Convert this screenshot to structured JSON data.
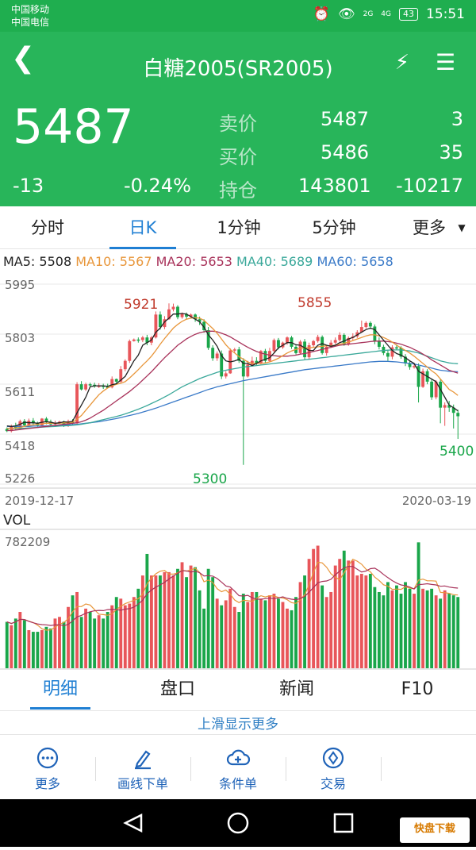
{
  "status": {
    "carrier1": "中国移动",
    "carrier2": "中国电信",
    "net1": "2G",
    "net2": "4G",
    "battery": "43",
    "time": "15:51"
  },
  "header": {
    "title": "白糖2005(SR2005)",
    "price": "5487",
    "change": "-13",
    "change_pct": "-0.24%",
    "sell_label": "卖价",
    "sell_price": "5487",
    "sell_vol": "3",
    "buy_label": "买价",
    "buy_price": "5486",
    "buy_vol": "35",
    "oi_label": "持仓",
    "oi": "143801",
    "oi_change": "-10217"
  },
  "tabs": {
    "t0": "分时",
    "t1": "日K",
    "t2": "1分钟",
    "t3": "5分钟",
    "t4": "更多"
  },
  "ma": {
    "ma5": "MA5: 5508",
    "ma10": "MA10: 5567",
    "ma20": "MA20: 5653",
    "ma40": "MA40: 5689",
    "ma60": "MA60: 5658"
  },
  "colors": {
    "up": "#e8565a",
    "down": "#1aa64a",
    "ma5": "#222222",
    "ma10": "#e8963a",
    "ma20": "#a8325a",
    "ma40": "#3aa89a",
    "ma60": "#3a7ac8",
    "header": "#28b55a",
    "accent": "#1f7fd3"
  },
  "chart_data": {
    "type": "candlestick",
    "y_ticks": [
      "5995",
      "5803",
      "5611",
      "5418",
      "5226"
    ],
    "ylim": [
      5226,
      5995
    ],
    "x_start": "2019-12-17",
    "x_end": "2020-03-19",
    "high_label": "5921",
    "low_label": "5300",
    "mid_label": "5855",
    "last_label": "5400",
    "vol_title": "VOL",
    "vol_max": "782209",
    "candles": [
      [
        5438,
        5430,
        5444,
        5426,
        280
      ],
      [
        5430,
        5450,
        5455,
        5425,
        260
      ],
      [
        5450,
        5440,
        5462,
        5432,
        300
      ],
      [
        5440,
        5468,
        5474,
        5438,
        340
      ],
      [
        5468,
        5452,
        5476,
        5446,
        290
      ],
      [
        5452,
        5470,
        5478,
        5448,
        230
      ],
      [
        5470,
        5460,
        5480,
        5452,
        220
      ],
      [
        5460,
        5452,
        5466,
        5446,
        220
      ],
      [
        5452,
        5478,
        5480,
        5448,
        230
      ],
      [
        5478,
        5466,
        5484,
        5456,
        250
      ],
      [
        5466,
        5456,
        5474,
        5448,
        240
      ],
      [
        5456,
        5462,
        5470,
        5452,
        300
      ],
      [
        5462,
        5466,
        5470,
        5458,
        310
      ],
      [
        5466,
        5452,
        5470,
        5446,
        280
      ],
      [
        5452,
        5468,
        5474,
        5446,
        370
      ],
      [
        5468,
        5460,
        5476,
        5454,
        440
      ],
      [
        5460,
        5610,
        5618,
        5456,
        460
      ],
      [
        5610,
        5590,
        5622,
        5586,
        310
      ],
      [
        5590,
        5610,
        5616,
        5584,
        360
      ],
      [
        5610,
        5608,
        5616,
        5598,
        340
      ],
      [
        5608,
        5602,
        5616,
        5596,
        300
      ],
      [
        5602,
        5604,
        5614,
        5596,
        320
      ],
      [
        5604,
        5600,
        5612,
        5592,
        300
      ],
      [
        5600,
        5598,
        5612,
        5594,
        340
      ],
      [
        5598,
        5630,
        5640,
        5594,
        380
      ],
      [
        5630,
        5620,
        5632,
        5614,
        430
      ],
      [
        5620,
        5668,
        5680,
        5616,
        420
      ],
      [
        5668,
        5700,
        5706,
        5660,
        380
      ],
      [
        5700,
        5776,
        5782,
        5692,
        390
      ],
      [
        5776,
        5782,
        5786,
        5774,
        430
      ],
      [
        5782,
        5780,
        5790,
        5770,
        480
      ],
      [
        5780,
        5790,
        5796,
        5772,
        560
      ],
      [
        5790,
        5770,
        5800,
        5760,
        690
      ],
      [
        5770,
        5790,
        5796,
        5760,
        560
      ],
      [
        5790,
        5878,
        5890,
        5786,
        560
      ],
      [
        5878,
        5830,
        5890,
        5820,
        560
      ],
      [
        5830,
        5860,
        5872,
        5822,
        580
      ],
      [
        5860,
        5898,
        5921,
        5858,
        580
      ],
      [
        5898,
        5908,
        5920,
        5890,
        560
      ],
      [
        5908,
        5868,
        5914,
        5860,
        600
      ],
      [
        5868,
        5880,
        5886,
        5862,
        640
      ],
      [
        5880,
        5870,
        5886,
        5860,
        550
      ],
      [
        5870,
        5878,
        5882,
        5864,
        620
      ],
      [
        5878,
        5860,
        5882,
        5850,
        610
      ],
      [
        5860,
        5850,
        5870,
        5838,
        470
      ],
      [
        5850,
        5818,
        5860,
        5808,
        360
      ],
      [
        5818,
        5750,
        5830,
        5742,
        600
      ],
      [
        5750,
        5710,
        5760,
        5700,
        550
      ],
      [
        5710,
        5728,
        5736,
        5700,
        420
      ],
      [
        5728,
        5640,
        5740,
        5630,
        380
      ],
      [
        5640,
        5652,
        5660,
        5632,
        410
      ],
      [
        5652,
        5740,
        5748,
        5650,
        480
      ],
      [
        5740,
        5744,
        5750,
        5732,
        370
      ],
      [
        5744,
        5700,
        5754,
        5692,
        340
      ],
      [
        5700,
        5640,
        5710,
        5300,
        450
      ],
      [
        5640,
        5686,
        5700,
        5636,
        400
      ],
      [
        5686,
        5700,
        5716,
        5682,
        460
      ],
      [
        5700,
        5690,
        5714,
        5684,
        460
      ],
      [
        5690,
        5738,
        5742,
        5686,
        420
      ],
      [
        5738,
        5700,
        5746,
        5690,
        410
      ],
      [
        5700,
        5738,
        5750,
        5696,
        440
      ],
      [
        5738,
        5780,
        5786,
        5730,
        450
      ],
      [
        5780,
        5752,
        5788,
        5744,
        420
      ],
      [
        5752,
        5770,
        5774,
        5746,
        400
      ],
      [
        5770,
        5790,
        5794,
        5762,
        360
      ],
      [
        5790,
        5754,
        5796,
        5746,
        350
      ],
      [
        5754,
        5730,
        5760,
        5724,
        430
      ],
      [
        5730,
        5774,
        5780,
        5726,
        520
      ],
      [
        5774,
        5714,
        5784,
        5706,
        560
      ],
      [
        5714,
        5760,
        5770,
        5706,
        660
      ],
      [
        5760,
        5776,
        5780,
        5752,
        720
      ],
      [
        5776,
        5792,
        5800,
        5770,
        740
      ],
      [
        5792,
        5730,
        5798,
        5724,
        500
      ],
      [
        5730,
        5754,
        5758,
        5720,
        430
      ],
      [
        5754,
        5770,
        5780,
        5750,
        460
      ],
      [
        5770,
        5780,
        5790,
        5764,
        620
      ],
      [
        5780,
        5800,
        5810,
        5774,
        660
      ],
      [
        5800,
        5764,
        5806,
        5758,
        710
      ],
      [
        5764,
        5788,
        5794,
        5758,
        650
      ],
      [
        5788,
        5794,
        5806,
        5780,
        650
      ],
      [
        5794,
        5810,
        5818,
        5788,
        560
      ],
      [
        5810,
        5830,
        5855,
        5808,
        570
      ],
      [
        5830,
        5846,
        5852,
        5824,
        560
      ],
      [
        5846,
        5832,
        5852,
        5822,
        570
      ],
      [
        5832,
        5776,
        5840,
        5764,
        490
      ],
      [
        5776,
        5754,
        5790,
        5744,
        460
      ],
      [
        5754,
        5730,
        5762,
        5722,
        440
      ],
      [
        5730,
        5716,
        5740,
        5700,
        520
      ],
      [
        5716,
        5752,
        5760,
        5706,
        470
      ],
      [
        5752,
        5750,
        5764,
        5742,
        500
      ],
      [
        5750,
        5716,
        5756,
        5708,
        450
      ],
      [
        5716,
        5690,
        5726,
        5680,
        520
      ],
      [
        5690,
        5676,
        5700,
        5666,
        480
      ],
      [
        5676,
        5680,
        5690,
        5670,
        450
      ],
      [
        5680,
        5600,
        5690,
        5540,
        760
      ],
      [
        5600,
        5660,
        5670,
        5596,
        480
      ],
      [
        5660,
        5620,
        5668,
        5610,
        470
      ],
      [
        5620,
        5560,
        5630,
        5550,
        480
      ],
      [
        5560,
        5620,
        5626,
        5552,
        440
      ],
      [
        5620,
        5520,
        5630,
        5460,
        420
      ],
      [
        5520,
        5530,
        5540,
        5450,
        470
      ],
      [
        5530,
        5520,
        5546,
        5504,
        450
      ],
      [
        5520,
        5500,
        5532,
        5440,
        440
      ],
      [
        5500,
        5487,
        5512,
        5400,
        430
      ]
    ],
    "ma_series": {
      "ma5": [
        5450,
        5448,
        5450,
        5456,
        5464,
        5462,
        5462,
        5460,
        5464,
        5466,
        5464,
        5460,
        5462,
        5466,
        5464,
        5468,
        5500,
        5530,
        5560,
        5600,
        5604,
        5604,
        5604,
        5602,
        5608,
        5612,
        5626,
        5640,
        5670,
        5700,
        5722,
        5760,
        5770,
        5780,
        5810,
        5826,
        5850,
        5864,
        5880,
        5880,
        5882,
        5880,
        5870,
        5860,
        5850,
        5830,
        5800,
        5780,
        5756,
        5720,
        5700,
        5696,
        5700,
        5706,
        5690,
        5690,
        5682,
        5690,
        5700,
        5706,
        5712,
        5730,
        5750,
        5760,
        5770,
        5770,
        5762,
        5760,
        5750,
        5740,
        5740,
        5760,
        5766,
        5760,
        5756,
        5760,
        5770,
        5776,
        5784,
        5790,
        5800,
        5810,
        5820,
        5826,
        5820,
        5800,
        5780,
        5760,
        5740,
        5728,
        5722,
        5712,
        5700,
        5690,
        5660,
        5650,
        5640,
        5630,
        5620,
        5590,
        5560,
        5530,
        5520,
        5508
      ],
      "ma10": [
        5440,
        5440,
        5442,
        5444,
        5448,
        5452,
        5454,
        5456,
        5458,
        5460,
        5460,
        5460,
        5460,
        5462,
        5462,
        5464,
        5476,
        5490,
        5510,
        5530,
        5550,
        5570,
        5584,
        5596,
        5604,
        5610,
        5614,
        5620,
        5634,
        5650,
        5666,
        5684,
        5700,
        5718,
        5740,
        5764,
        5786,
        5806,
        5826,
        5840,
        5852,
        5860,
        5864,
        5866,
        5864,
        5856,
        5840,
        5824,
        5806,
        5784,
        5762,
        5744,
        5730,
        5716,
        5706,
        5696,
        5690,
        5690,
        5690,
        5692,
        5696,
        5702,
        5710,
        5720,
        5730,
        5738,
        5744,
        5748,
        5750,
        5750,
        5752,
        5754,
        5756,
        5758,
        5758,
        5760,
        5764,
        5768,
        5772,
        5778,
        5784,
        5790,
        5796,
        5800,
        5800,
        5796,
        5790,
        5782,
        5772,
        5760,
        5750,
        5740,
        5730,
        5718,
        5704,
        5690,
        5676,
        5662,
        5650,
        5630,
        5610,
        5590,
        5580,
        5567
      ],
      "ma20": [
        5432,
        5432,
        5434,
        5436,
        5438,
        5440,
        5442,
        5444,
        5446,
        5448,
        5450,
        5452,
        5454,
        5456,
        5458,
        5460,
        5462,
        5466,
        5472,
        5480,
        5490,
        5500,
        5510,
        5522,
        5534,
        5546,
        5558,
        5570,
        5582,
        5596,
        5610,
        5626,
        5642,
        5658,
        5676,
        5694,
        5712,
        5728,
        5744,
        5760,
        5772,
        5784,
        5794,
        5802,
        5808,
        5812,
        5814,
        5814,
        5812,
        5806,
        5800,
        5792,
        5782,
        5772,
        5762,
        5752,
        5744,
        5736,
        5730,
        5726,
        5722,
        5720,
        5718,
        5718,
        5718,
        5720,
        5722,
        5726,
        5728,
        5732,
        5736,
        5740,
        5744,
        5748,
        5752,
        5756,
        5760,
        5762,
        5764,
        5766,
        5768,
        5770,
        5772,
        5774,
        5776,
        5776,
        5776,
        5774,
        5772,
        5768,
        5764,
        5758,
        5752,
        5744,
        5736,
        5726,
        5716,
        5704,
        5694,
        5684,
        5674,
        5664,
        5658,
        5653
      ],
      "ma40": [
        5440,
        5440,
        5440,
        5440,
        5441,
        5442,
        5443,
        5444,
        5445,
        5446,
        5447,
        5448,
        5449,
        5450,
        5451,
        5452,
        5454,
        5456,
        5459,
        5462,
        5466,
        5470,
        5474,
        5478,
        5482,
        5486,
        5491,
        5496,
        5502,
        5508,
        5514,
        5521,
        5528,
        5536,
        5544,
        5552,
        5561,
        5570,
        5580,
        5590,
        5600,
        5608,
        5616,
        5624,
        5632,
        5638,
        5644,
        5650,
        5656,
        5660,
        5664,
        5667,
        5670,
        5673,
        5676,
        5678,
        5680,
        5682,
        5684,
        5686,
        5688,
        5690,
        5692,
        5694,
        5696,
        5698,
        5700,
        5702,
        5704,
        5706,
        5708,
        5710,
        5712,
        5714,
        5716,
        5718,
        5720,
        5722,
        5724,
        5726,
        5728,
        5730,
        5732,
        5734,
        5736,
        5738,
        5740,
        5741,
        5742,
        5742,
        5742,
        5740,
        5738,
        5734,
        5730,
        5724,
        5718,
        5712,
        5706,
        5700,
        5696,
        5692,
        5690,
        5689
      ],
      "ma60": [
        5448,
        5448,
        5448,
        5448,
        5448,
        5448,
        5449,
        5449,
        5450,
        5450,
        5451,
        5451,
        5452,
        5453,
        5454,
        5455,
        5456,
        5458,
        5460,
        5462,
        5464,
        5466,
        5469,
        5472,
        5475,
        5478,
        5482,
        5486,
        5490,
        5494,
        5498,
        5503,
        5508,
        5513,
        5518,
        5524,
        5530,
        5536,
        5542,
        5548,
        5554,
        5560,
        5566,
        5572,
        5578,
        5584,
        5590,
        5595,
        5600,
        5604,
        5608,
        5612,
        5616,
        5620,
        5624,
        5627,
        5630,
        5633,
        5636,
        5639,
        5642,
        5645,
        5648,
        5651,
        5654,
        5657,
        5660,
        5663,
        5666,
        5668,
        5670,
        5672,
        5674,
        5676,
        5678,
        5680,
        5682,
        5684,
        5686,
        5688,
        5690,
        5692,
        5694,
        5696,
        5697,
        5698,
        5698,
        5698,
        5697,
        5696,
        5694,
        5692,
        5690,
        5688,
        5684,
        5680,
        5676,
        5672,
        5668,
        5664,
        5662,
        5660,
        5659,
        5658
      ]
    }
  },
  "bottom_tabs": {
    "b0": "明细",
    "b1": "盘口",
    "b2": "新闻",
    "b3": "F10"
  },
  "hint": "上滑显示更多",
  "actions": {
    "a0": "更多",
    "a1": "画线下单",
    "a2": "条件单",
    "a3": "交易"
  },
  "icons": {
    "back": "chevron-left-icon",
    "bolt": "lightning-icon",
    "menu": "list-menu-icon",
    "more": "dots-circle-icon",
    "draw": "pen-icon",
    "cond": "cloud-plus-icon",
    "trade": "compass-icon"
  },
  "watermark": "快盘下载"
}
